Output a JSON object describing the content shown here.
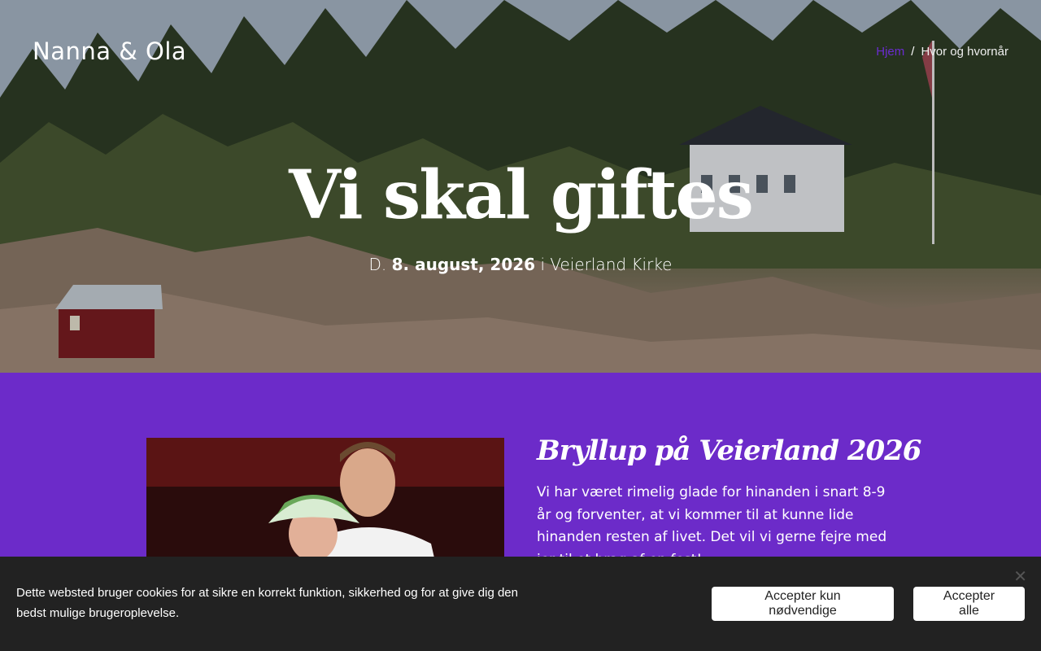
{
  "header": {
    "brand": "Nanna & Ola",
    "breadcrumb": {
      "home": "Hjem",
      "separator": "/",
      "current": "Hvor og hvornår"
    }
  },
  "hero": {
    "title": "Vi skal giftes",
    "subtitle_prefix": "D.",
    "date": "8. august, 2026",
    "subtitle_mid": "i",
    "place": "Veierland Kirke"
  },
  "section": {
    "title": "Bryllup på Veierland 2026",
    "body": "Vi har været rimelig glade for hinanden i snart 8-9 år og forventer, at vi kommer til at kunne lide hinanden resten af livet. Det vil vi gerne fejre med jer til et brag af en fest!"
  },
  "cookie": {
    "text": "Dette websted bruger cookies for at sikre en korrekt funktion, sikkerhed og for at give dig den bedst mulige brugeroplevelse.",
    "close": "✕",
    "btn_necessary": "Accepter kun nødvendige",
    "btn_all": "Accepter alle"
  },
  "colors": {
    "section_bg": "#6c2bc9",
    "cookie_bg": "#222222",
    "link": "#6a2bd0"
  }
}
